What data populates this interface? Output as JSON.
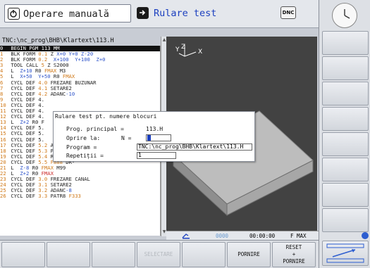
{
  "header": {
    "mode_manual": "Operare manuală",
    "mode_test": "Rulare test",
    "dnc_label": "DNC",
    "colors": {
      "test_mode_text": "#1b3fbf",
      "highlight_orange": "#d07a1a"
    }
  },
  "editor": {
    "path": "TNC:\\nc_prog\\BHB\\Klartext\\113.H",
    "lines": [
      {
        "n": "0",
        "text": "BEGIN PGM 113 MM",
        "selected": true
      },
      {
        "n": "1",
        "text": "BLK FORM 0.1 Z X+0 Y+0 Z-20"
      },
      {
        "n": "2",
        "text": "BLK FORM 0.2  X+100  Y+100  Z+0"
      },
      {
        "n": "3",
        "text": "TOOL CALL 5 Z S2000"
      },
      {
        "n": "4",
        "text": "L  Z+10 R0 FMAX M3"
      },
      {
        "n": "5",
        "text": "L  X+50  Y+50 R0 FMAX"
      },
      {
        "n": "6",
        "text": "CYCL DEF 4.0 FREZARE BUZUNAR"
      },
      {
        "n": "7",
        "text": "CYCL DEF 4.1 SETARE2"
      },
      {
        "n": "8",
        "text": "CYCL DEF 4.2 ADANC-10"
      },
      {
        "n": "9",
        "text": "CYCL DEF 4."
      },
      {
        "n": "10",
        "text": "CYCL DEF 4."
      },
      {
        "n": "11",
        "text": "CYCL DEF 4."
      },
      {
        "n": "12",
        "text": "CYCL DEF 4."
      },
      {
        "n": "13",
        "text": "L  Z+2 R0 F"
      },
      {
        "n": "14",
        "text": "CYCL DEF 5."
      },
      {
        "n": "15",
        "text": "CYCL DEF 5."
      },
      {
        "n": "16",
        "text": "CYCL DEF 5."
      },
      {
        "n": "17",
        "text": "CYCL DEF 5.2 ADANC-10"
      },
      {
        "n": "18",
        "text": "CYCL DEF 5.3 PATR10 F333"
      },
      {
        "n": "19",
        "text": "CYCL DEF 5.4 RAZA15"
      },
      {
        "n": "20",
        "text": "CYCL DEF 5.5 F888 DR-"
      },
      {
        "n": "21",
        "text": "L  Z-8 R0 FMAX M99"
      },
      {
        "n": "22",
        "text": "L  Z+2 R0 FMAX"
      },
      {
        "n": "23",
        "text": "CYCL DEF 3.0 FREZARE CANAL"
      },
      {
        "n": "24",
        "text": "CYCL DEF 3.1 SETARE2"
      },
      {
        "n": "25",
        "text": "CYCL DEF 3.2 ADANC-8"
      },
      {
        "n": "26",
        "text": "CYCL DEF 3.3 PATR8 F333"
      }
    ]
  },
  "graphics": {
    "axis_label": "YZ X"
  },
  "dialog": {
    "title": "Rulare test pt. numere blocuri",
    "main_prog_label": "Prog. principal =",
    "main_prog_value": "113.H",
    "stop_label": "Oprire la:",
    "stop_n_label": "N =",
    "stop_value": "0",
    "program_label": "Program =",
    "program_value": "TNC:\\nc_prog\\BHB\\Klartext\\113.H",
    "repeat_label": "Repetiții =",
    "repeat_value": "1"
  },
  "status": {
    "dots": "0000",
    "time": "00:00:00",
    "feed": "F MAX"
  },
  "softkeys": {
    "k1": "",
    "k2": "",
    "k3": "",
    "k4": "SELECTARE",
    "k5": "",
    "k6": "PORNIRE",
    "k7_line1": "RESET",
    "k7_line2": "+",
    "k7_line3": "PORNIRE"
  }
}
